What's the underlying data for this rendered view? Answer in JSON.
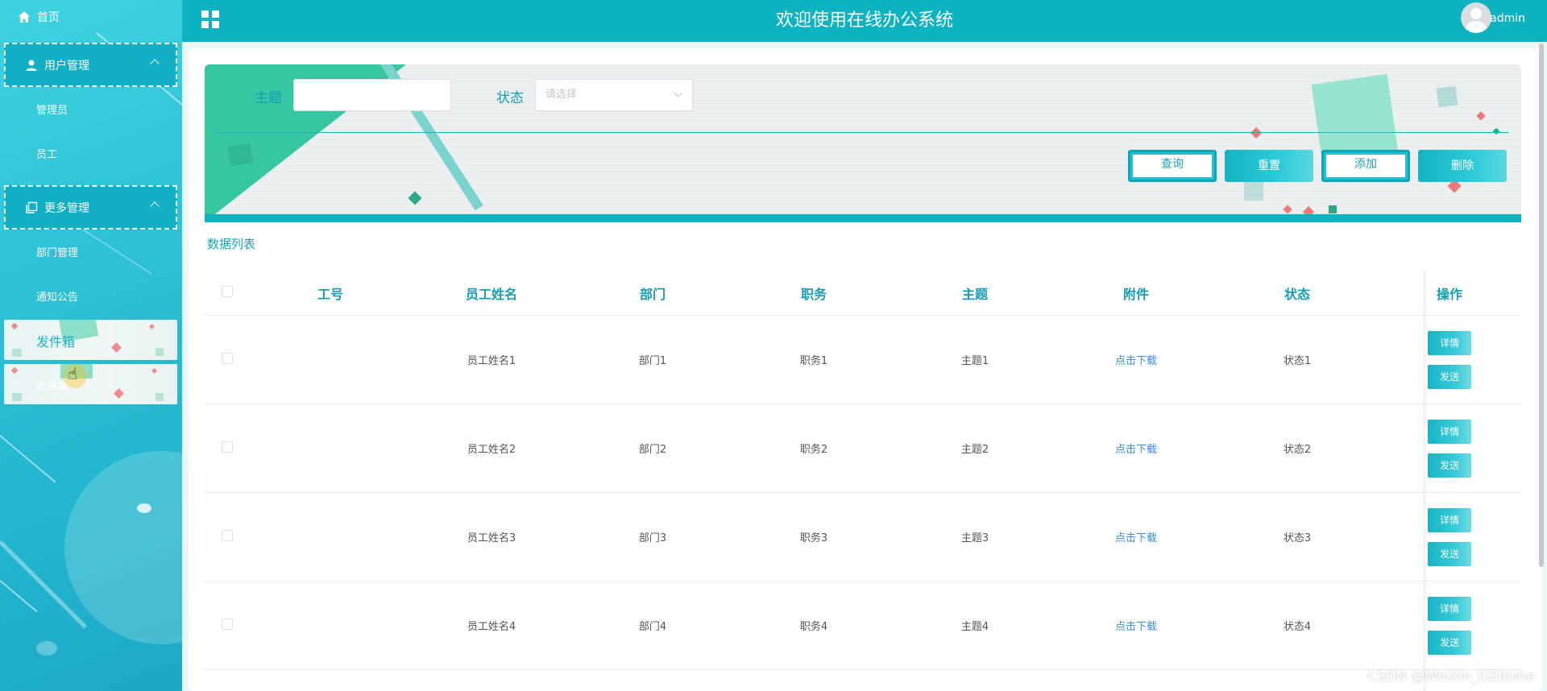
{
  "header": {
    "title": "欢迎使用在线办公系统",
    "username": "admin"
  },
  "sidebar": {
    "home": "首页",
    "groups": [
      {
        "label": "用户管理",
        "items": [
          "管理员",
          "员工"
        ]
      },
      {
        "label": "更多管理",
        "items": [
          "部门管理",
          "通知公告"
        ]
      }
    ],
    "cards": [
      "发件箱",
      "收件箱"
    ]
  },
  "search": {
    "subject_label": "主题",
    "subject_value": "",
    "status_label": "状态",
    "status_placeholder": "请选择",
    "buttons": {
      "query": "查询",
      "reset": "重置",
      "add": "添加",
      "delete": "删除"
    }
  },
  "list_title": "数据列表",
  "table": {
    "headers": [
      "工号",
      "员工姓名",
      "部门",
      "职务",
      "主题",
      "附件",
      "状态",
      "操作"
    ],
    "rows": [
      {
        "id": "",
        "name": "员工姓名1",
        "dept": "部门1",
        "position": "职务1",
        "subject": "主题1",
        "attachment": "点击下载",
        "status": "状态1"
      },
      {
        "id": "",
        "name": "员工姓名2",
        "dept": "部门2",
        "position": "职务2",
        "subject": "主题2",
        "attachment": "点击下载",
        "status": "状态2"
      },
      {
        "id": "",
        "name": "员工姓名3",
        "dept": "部门3",
        "position": "职务3",
        "subject": "主题3",
        "attachment": "点击下载",
        "status": "状态3"
      },
      {
        "id": "",
        "name": "员工姓名4",
        "dept": "部门4",
        "position": "职务4",
        "subject": "主题4",
        "attachment": "点击下载",
        "status": "状态4"
      }
    ],
    "op_detail": "详情",
    "op_send": "发送"
  },
  "watermark": "CSDN @WeiXin_DZbishe",
  "colors": {
    "primary": "#0eb3c2",
    "sidebar": "#2ec3d6",
    "accent_green": "#36c6a2",
    "link": "#3b8fd6"
  }
}
